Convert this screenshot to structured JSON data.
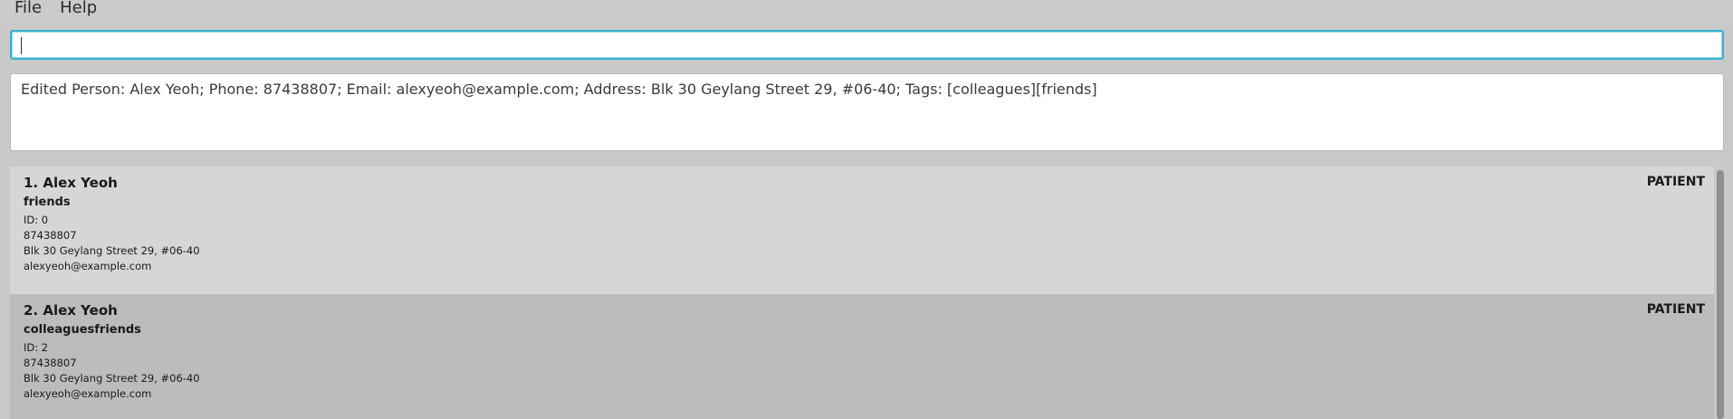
{
  "menu": {
    "file": "File",
    "help": "Help"
  },
  "command": {
    "value": "",
    "placeholder": ""
  },
  "result": {
    "message": "Edited Person: Alex Yeoh; Phone: 87438807; Email: alexyeoh@example.com; Address: Blk 30 Geylang Street 29, #06-40; Tags: [colleagues][friends]"
  },
  "persons": [
    {
      "name": "1. Alex Yeoh",
      "role": "PATIENT",
      "tags": "friends",
      "id": "ID: 0",
      "phone": "87438807",
      "address": "Blk 30 Geylang Street 29, #06-40",
      "email": "alexyeoh@example.com"
    },
    {
      "name": "2. Alex Yeoh",
      "role": "PATIENT",
      "tags": "colleaguesfriends",
      "id": "ID: 2",
      "phone": "87438807",
      "address": "Blk 30 Geylang Street 29, #06-40",
      "email": "alexyeoh@example.com"
    }
  ],
  "colors": {
    "accent": "#35b1d1",
    "background": "#c9c9c9",
    "card_even": "#d6d6d6",
    "card_odd": "#bcbcbc"
  }
}
